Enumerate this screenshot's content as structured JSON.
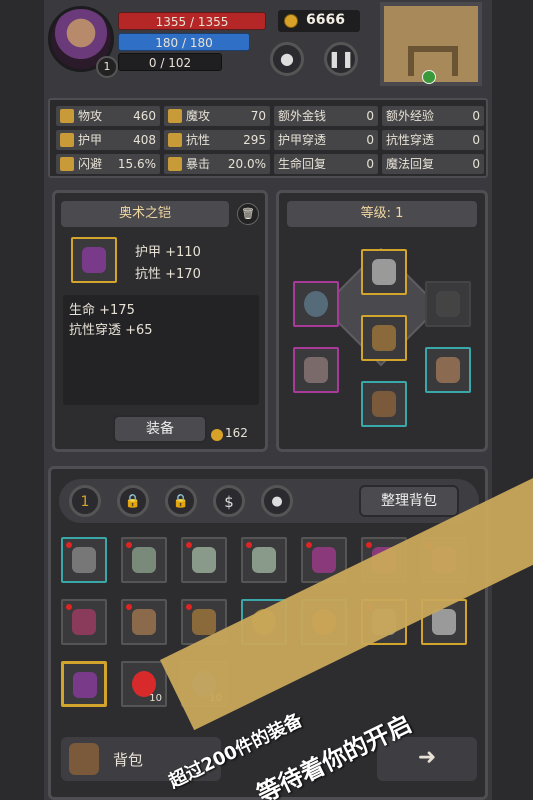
{
  "hud": {
    "hp": "1355 / 1355",
    "mp": "180 / 180",
    "xp": "0 / 102",
    "level": "1",
    "gold": "6666"
  },
  "stats": [
    {
      "label": "物攻",
      "value": "460"
    },
    {
      "label": "魔攻",
      "value": "70"
    },
    {
      "label": "额外金钱",
      "value": "0"
    },
    {
      "label": "额外经验",
      "value": "0"
    },
    {
      "label": "护甲",
      "value": "408"
    },
    {
      "label": "抗性",
      "value": "295"
    },
    {
      "label": "护甲穿透",
      "value": "0"
    },
    {
      "label": "抗性穿透",
      "value": "0"
    },
    {
      "label": "闪避",
      "value": "15.6%"
    },
    {
      "label": "暴击",
      "value": "20.0%"
    },
    {
      "label": "生命回复",
      "value": "0"
    },
    {
      "label": "魔法回复",
      "value": "0"
    }
  ],
  "item_panel": {
    "name": "奥术之铠",
    "stat1": "护甲 +110",
    "stat2": "抗性 +170",
    "bonus1": "生命 +175",
    "bonus2": "抗性穿透 +65",
    "equip_label": "装备",
    "price": "162"
  },
  "equip_panel": {
    "title": "等级: 1"
  },
  "bag_toolbar": {
    "page": "1",
    "sort_label": "整理背包"
  },
  "inventory": {
    "potion_count_red": "10",
    "potion_count_blue": "10"
  },
  "bottom": {
    "bag_label": "背包"
  },
  "promo": {
    "line1": "超过200件的装备",
    "line2": "等待着你的开启"
  },
  "colors": {
    "hp": "#b52626",
    "mp": "#2f6fc5",
    "gold": "#d8a228",
    "rare_border": "#d4a52c",
    "uncommon_border": "#3aa8a8",
    "epic_border": "#a83a9a"
  }
}
